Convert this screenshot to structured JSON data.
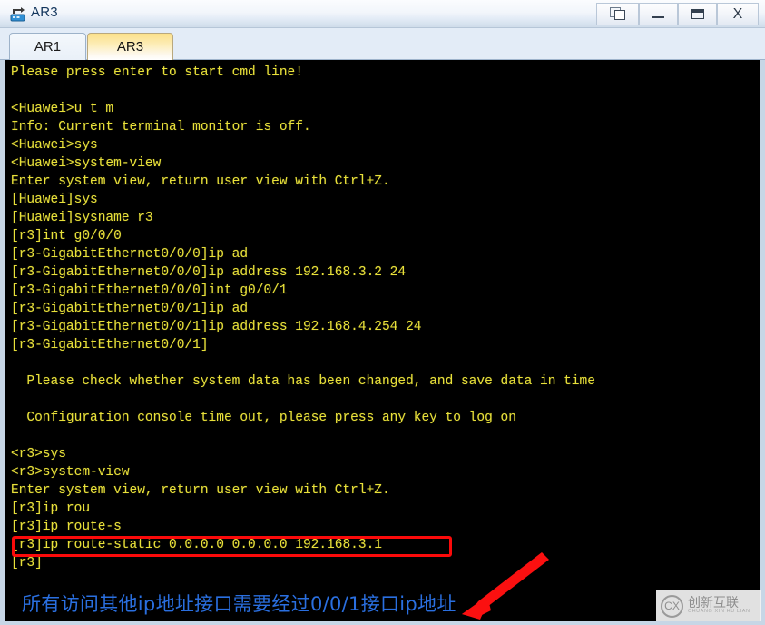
{
  "window": {
    "title": "AR3",
    "icon": "router-icon",
    "controls": [
      {
        "name": "restore-all-button",
        "label": ""
      },
      {
        "name": "minimize-button",
        "label": ""
      },
      {
        "name": "maximize-button",
        "label": ""
      },
      {
        "name": "close-button",
        "label": "X"
      }
    ]
  },
  "tabs": [
    {
      "label": "AR1",
      "active": false
    },
    {
      "label": "AR3",
      "active": true
    }
  ],
  "terminal": {
    "lines": "Please press enter to start cmd line!\n\n<Huawei>u t m\nInfo: Current terminal monitor is off.\n<Huawei>sys\n<Huawei>system-view\nEnter system view, return user view with Ctrl+Z.\n[Huawei]sys\n[Huawei]sysname r3\n[r3]int g0/0/0\n[r3-GigabitEthernet0/0/0]ip ad\n[r3-GigabitEthernet0/0/0]ip address 192.168.3.2 24\n[r3-GigabitEthernet0/0/0]int g0/0/1\n[r3-GigabitEthernet0/0/1]ip ad\n[r3-GigabitEthernet0/0/1]ip address 192.168.4.254 24\n[r3-GigabitEthernet0/0/1]\n\n  Please check whether system data has been changed, and save data in time\n\n  Configuration console time out, please press any key to log on\n\n<r3>sys\n<r3>system-view\nEnter system view, return user view with Ctrl+Z.\n[r3]ip rou\n[r3]ip route-s\n[r3]ip route-static 0.0.0.0 0.0.0.0 192.168.3.1\n[r3]",
    "text_color": "#e8e03a",
    "background_color": "#000000"
  },
  "annotations": {
    "highlight_box": {
      "color": "#fb0a0a",
      "target_command": "[r3]ip route-static 0.0.0.0 0.0.0.0 192.168.3.1"
    },
    "arrow": {
      "color": "#fb0a0a",
      "direction": "down-left"
    },
    "note": {
      "text": "所有访问其他ip地址接口需要经过0/0/1接口ip地址",
      "color": "#2a6fe0"
    }
  },
  "watermark": {
    "mark": "CX",
    "name_cn": "创新互联",
    "name_pinyin": "CHUANG XIN HU LIAN"
  }
}
